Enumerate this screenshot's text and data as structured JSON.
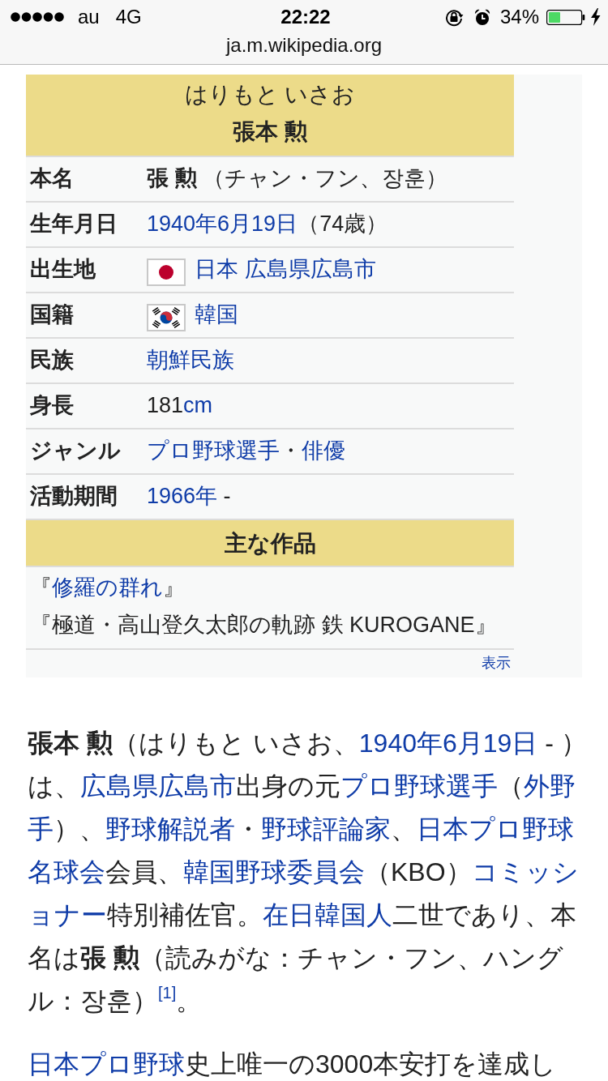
{
  "status_bar": {
    "carrier": "au",
    "network": "4G",
    "time": "22:22",
    "battery": "34%"
  },
  "address_bar": {
    "url": "ja.m.wikipedia.org"
  },
  "infobox": {
    "reading": "はりもと いさお",
    "name": "張本 勲",
    "rows": [
      {
        "label": "本名",
        "value": [
          {
            "kind": "text",
            "text": "**張 勲** （チャン・フン、장훈）"
          }
        ]
      },
      {
        "label": "生年月日",
        "value": [
          {
            "kind": "link",
            "text": "1940年6月19日"
          },
          {
            "kind": "text",
            "text": "（74歳）"
          }
        ]
      },
      {
        "label": "出生地",
        "value": [
          {
            "kind": "japan_flag"
          },
          {
            "kind": "link",
            "text": "日本 広島県広島市"
          }
        ]
      },
      {
        "label": "国籍",
        "value": [
          {
            "kind": "korea_flag"
          },
          {
            "kind": "link",
            "text": "韓国"
          }
        ]
      },
      {
        "label": "民族",
        "value": [
          {
            "kind": "link",
            "text": "朝鮮民族"
          }
        ]
      },
      {
        "label": "身長",
        "value": [
          {
            "kind": "text",
            "text": "181"
          },
          {
            "kind": "link",
            "text": "cm"
          }
        ]
      },
      {
        "label": "ジャンル",
        "value": [
          {
            "kind": "link",
            "text": "プロ野球選手"
          },
          {
            "kind": "text",
            "text": "・"
          },
          {
            "kind": "link",
            "text": "俳優"
          }
        ]
      },
      {
        "label": "活動期間",
        "value": [
          {
            "kind": "link",
            "text": "1966年"
          },
          {
            "kind": "text",
            "text": " -"
          }
        ]
      }
    ],
    "works_heading": "主な作品",
    "works": [
      [
        {
          "kind": "text",
          "text": "『"
        },
        {
          "kind": "link",
          "text": "修羅の群れ"
        },
        {
          "kind": "text",
          "text": "』"
        }
      ],
      [
        {
          "kind": "text",
          "text": "『極道・高山登久太郎の軌跡 鉄 KUROGANE』"
        }
      ]
    ],
    "show_link": "表示"
  },
  "article": {
    "paragraphs": [
      {
        "lines": [
          [
            {
              "kind": "text",
              "text": "**張本 勲**（はりもと いさお、"
            },
            {
              "kind": "link",
              "text": "1940年6月19日"
            },
            {
              "kind": "text",
              "text": " - ）"
            }
          ],
          [
            {
              "kind": "text",
              "text": "は、"
            },
            {
              "kind": "link",
              "text": "広島県広島市"
            },
            {
              "kind": "text",
              "text": "出身の元"
            },
            {
              "kind": "link",
              "text": "プロ野球選手"
            },
            {
              "kind": "text",
              "text": "（"
            },
            {
              "kind": "link",
              "text": "外野"
            }
          ],
          [
            {
              "kind": "link",
              "text": "手"
            },
            {
              "kind": "text",
              "text": "）、"
            },
            {
              "kind": "link",
              "text": "野球解説者"
            },
            {
              "kind": "text",
              "text": "・"
            },
            {
              "kind": "link",
              "text": "野球評論家"
            },
            {
              "kind": "text",
              "text": "、"
            },
            {
              "kind": "link",
              "text": "日本プロ野球"
            }
          ],
          [
            {
              "kind": "link",
              "text": "名球会"
            },
            {
              "kind": "text",
              "text": "会員、"
            },
            {
              "kind": "link",
              "text": "韓国野球委員会"
            },
            {
              "kind": "text",
              "text": "（KBO）"
            },
            {
              "kind": "link",
              "text": "コミッシ"
            }
          ],
          [
            {
              "kind": "link",
              "text": "ョナー"
            },
            {
              "kind": "text",
              "text": "特別補佐官。"
            },
            {
              "kind": "link",
              "text": "在日韓国人"
            },
            {
              "kind": "text",
              "text": "二世であり、本"
            }
          ],
          [
            {
              "kind": "text",
              "text": "名は**張 勲**（読みがな：チャン・フン、ハング"
            }
          ],
          [
            {
              "kind": "text",
              "text": "ル：장훈）"
            },
            {
              "kind": "ref",
              "text": "[1]"
            },
            {
              "kind": "text",
              "text": "。"
            }
          ]
        ]
      },
      {
        "lines": [
          [
            {
              "kind": "link",
              "text": "日本プロ野球"
            },
            {
              "kind": "text",
              "text": "史上唯一の3000本安打を達成し"
            }
          ]
        ]
      }
    ]
  }
}
